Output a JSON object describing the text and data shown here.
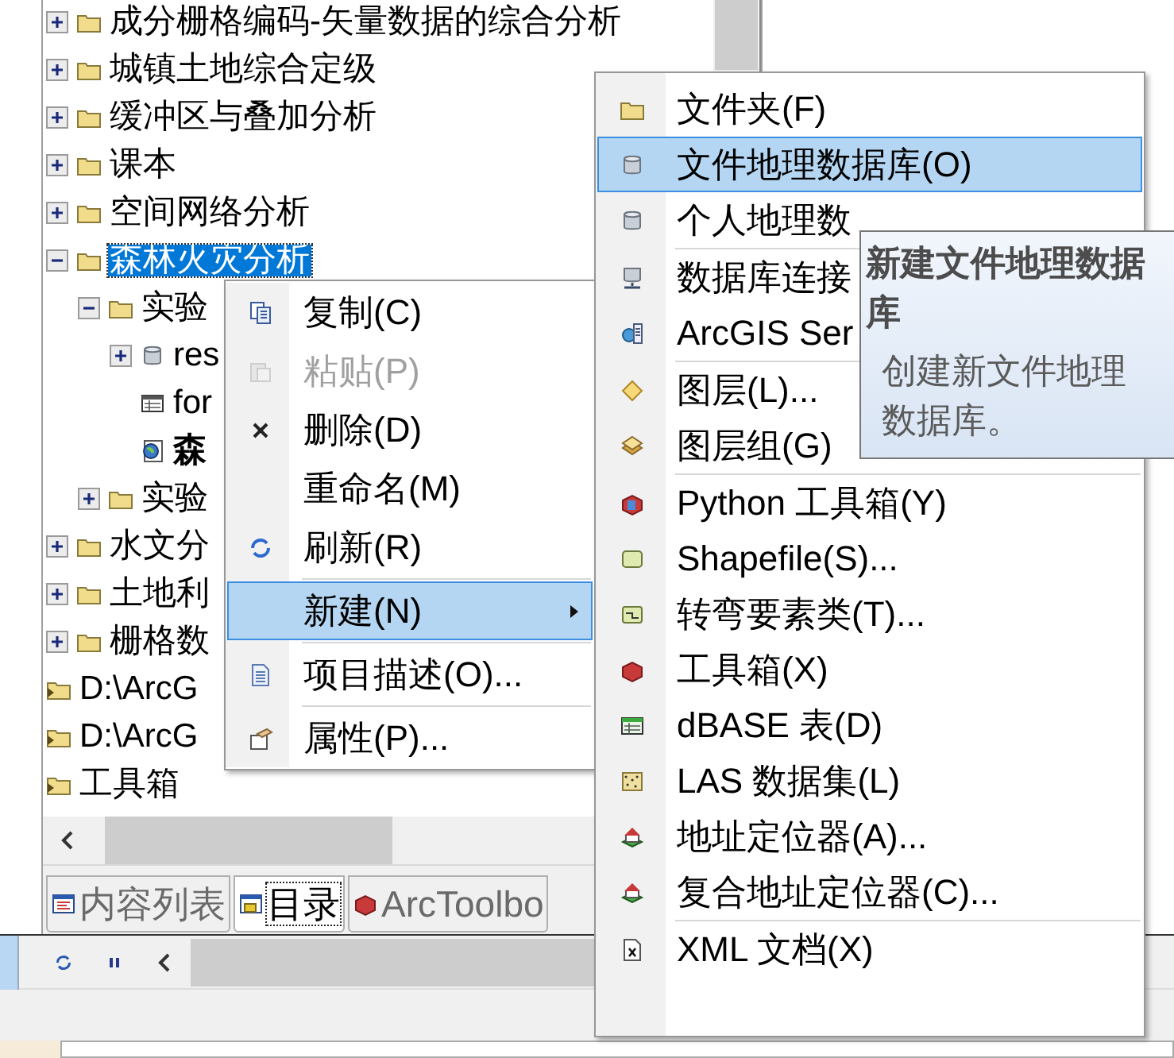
{
  "tree": [
    {
      "label": "成分栅格编码-矢量数据的综合分析",
      "kind": "folder",
      "expanded": false,
      "selected": false,
      "bold": false
    },
    {
      "label": "城镇土地综合定级",
      "kind": "folder",
      "expanded": false,
      "selected": false,
      "bold": false
    },
    {
      "label": "缓冲区与叠加分析",
      "kind": "folder",
      "expanded": false,
      "selected": false,
      "bold": false
    },
    {
      "label": "课本",
      "kind": "folder",
      "expanded": false,
      "selected": false,
      "bold": false
    },
    {
      "label": "空间网络分析",
      "kind": "folder",
      "expanded": false,
      "selected": false,
      "bold": false
    },
    {
      "label": "森林火灾分析",
      "kind": "folder",
      "expanded": true,
      "selected": true,
      "bold": false,
      "children": [
        {
          "label": "实验",
          "kind": "folder",
          "expanded": true,
          "selected": false,
          "bold": false,
          "children": [
            {
              "label": "res",
              "kind": "geodatabase",
              "expanded": false,
              "selected": false,
              "bold": false
            },
            {
              "label": "for",
              "kind": "table",
              "selected": false,
              "bold": false
            },
            {
              "label": "森",
              "kind": "map",
              "selected": false,
              "bold": true
            }
          ]
        },
        {
          "label": "实验",
          "kind": "folder",
          "expanded": false,
          "selected": false,
          "bold": false
        }
      ]
    },
    {
      "label": "水文分",
      "kind": "folder",
      "expanded": false,
      "selected": false,
      "bold": false
    },
    {
      "label": "土地利",
      "kind": "folder",
      "expanded": false,
      "selected": false,
      "bold": false
    },
    {
      "label": "栅格数",
      "kind": "folder",
      "expanded": false,
      "selected": false,
      "bold": false
    },
    {
      "label": "D:\\ArcG",
      "kind": "connection",
      "selected": false,
      "bold": false
    },
    {
      "label": "D:\\ArcG",
      "kind": "connection",
      "selected": false,
      "bold": false
    },
    {
      "label": "工具箱",
      "kind": "connection",
      "selected": false,
      "bold": false
    }
  ],
  "tabs": [
    {
      "label": "内容列表",
      "selected": false
    },
    {
      "label": "目录",
      "selected": true
    },
    {
      "label": "ArcToolbo",
      "selected": false
    }
  ],
  "context_menu": [
    {
      "kind": "item",
      "label": "复制(C)",
      "disabled": false,
      "selected": false,
      "submenu": false
    },
    {
      "kind": "item",
      "label": "粘贴(P)",
      "disabled": true,
      "selected": false,
      "submenu": false
    },
    {
      "kind": "item",
      "label": "删除(D)",
      "disabled": false,
      "selected": false,
      "submenu": false
    },
    {
      "kind": "item",
      "label": "重命名(M)",
      "disabled": false,
      "selected": false,
      "submenu": false
    },
    {
      "kind": "item",
      "label": "刷新(R)",
      "disabled": false,
      "selected": false,
      "submenu": false
    },
    {
      "kind": "separator"
    },
    {
      "kind": "item",
      "label": "新建(N)",
      "disabled": false,
      "selected": true,
      "submenu": true
    },
    {
      "kind": "separator"
    },
    {
      "kind": "item",
      "label": "项目描述(O)...",
      "disabled": false,
      "selected": false,
      "submenu": false
    },
    {
      "kind": "separator"
    },
    {
      "kind": "item",
      "label": "属性(P)...",
      "disabled": false,
      "selected": false,
      "submenu": false
    }
  ],
  "submenu": [
    {
      "kind": "item",
      "label": "文件夹(F)",
      "selected": false
    },
    {
      "kind": "item",
      "label": "文件地理数据库(O)",
      "selected": true
    },
    {
      "kind": "item",
      "label": "个人地理数",
      "selected": false
    },
    {
      "kind": "separator"
    },
    {
      "kind": "item",
      "label": "数据库连接",
      "selected": false
    },
    {
      "kind": "item",
      "label": "ArcGIS Ser",
      "selected": false
    },
    {
      "kind": "separator"
    },
    {
      "kind": "item",
      "label": "图层(L)...",
      "selected": false
    },
    {
      "kind": "item",
      "label": "图层组(G)",
      "selected": false
    },
    {
      "kind": "separator"
    },
    {
      "kind": "item",
      "label": "Python 工具箱(Y)",
      "selected": false
    },
    {
      "kind": "item",
      "label": "Shapefile(S)...",
      "selected": false
    },
    {
      "kind": "item",
      "label": "转弯要素类(T)...",
      "selected": false
    },
    {
      "kind": "item",
      "label": "工具箱(X)",
      "selected": false
    },
    {
      "kind": "item",
      "label": "dBASE 表(D)",
      "selected": false
    },
    {
      "kind": "item",
      "label": "LAS 数据集(L)",
      "selected": false
    },
    {
      "kind": "item",
      "label": "地址定位器(A)...",
      "selected": false
    },
    {
      "kind": "item",
      "label": "复合地址定位器(C)...",
      "selected": false
    },
    {
      "kind": "separator"
    },
    {
      "kind": "item",
      "label": "XML 文档(X)",
      "selected": false
    }
  ],
  "tooltip": {
    "title": "新建文件地理数据库",
    "text": "创建新文件地理数据库。"
  }
}
